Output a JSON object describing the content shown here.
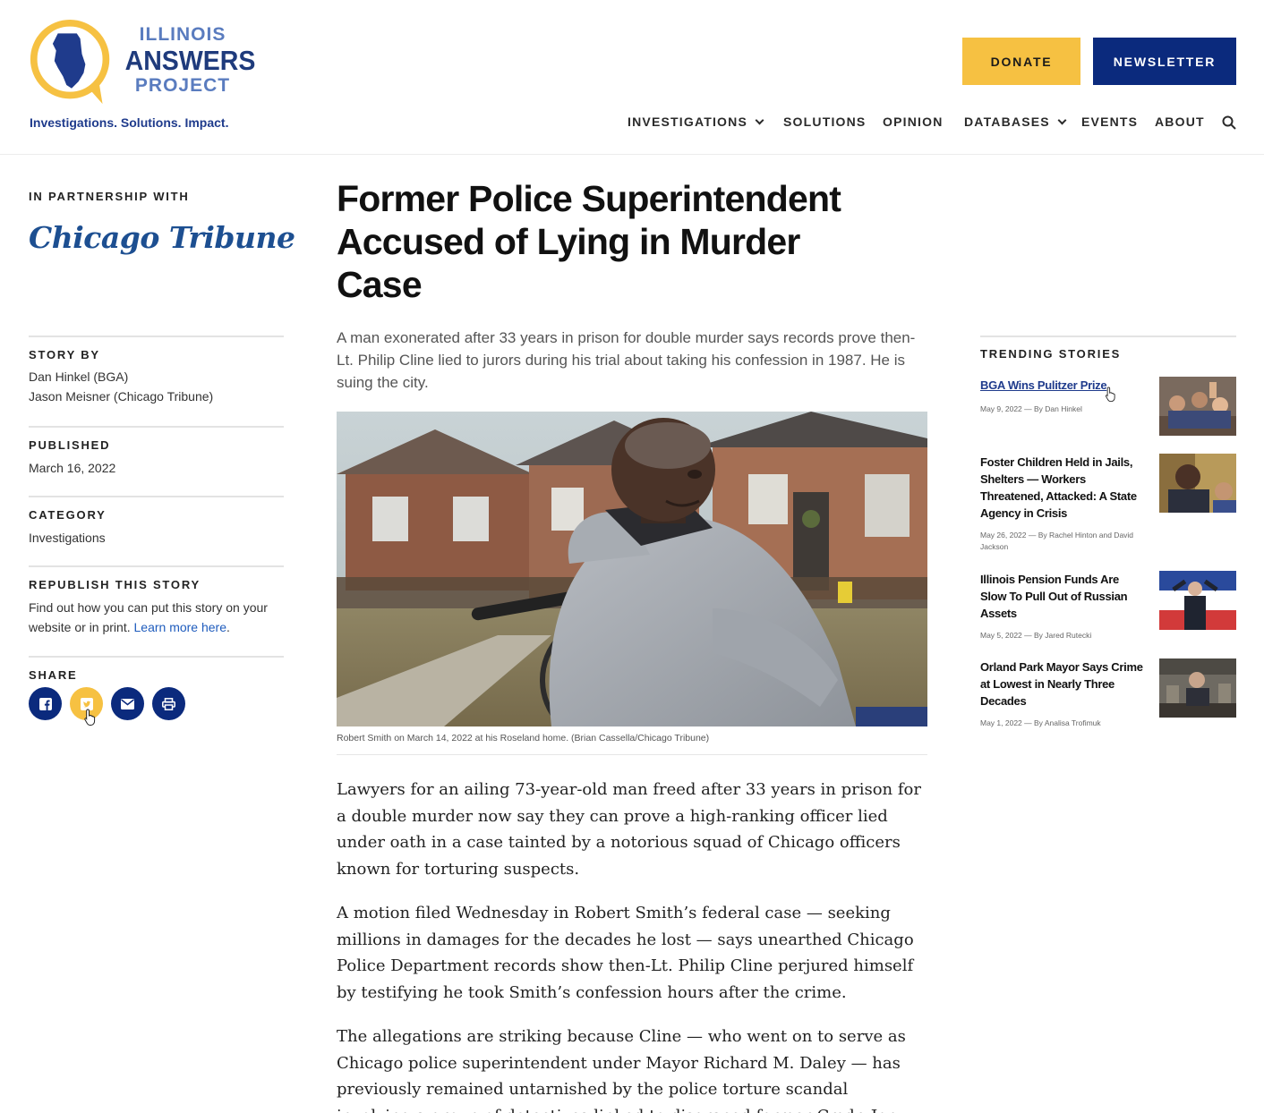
{
  "brand": {
    "logo_line1": "ILLINOIS",
    "logo_line2": "ANSWERS",
    "logo_line3": "PROJECT",
    "tagline": "Investigations. Solutions. Impact.",
    "primary_color": "#0b2a7d",
    "accent_color": "#f6c142"
  },
  "header": {
    "donate_label": "DONATE",
    "newsletter_label": "NEWSLETTER",
    "nav": [
      "INVESTIGATIONS",
      "SOLUTIONS",
      "OPINION",
      "DATABASES",
      "EVENTS",
      "ABOUT"
    ],
    "search_icon": "search-icon"
  },
  "sidebar": {
    "partner_label": "IN PARTNERSHIP WITH",
    "partner_name": "Chicago Tribune",
    "story_by_label": "STORY BY",
    "authors": [
      "Dan Hinkel (BGA)",
      "Jason Meisner (Chicago Tribune)"
    ],
    "published_label": "PUBLISHED",
    "published_date": "March 16, 2022",
    "category_label": "CATEGORY",
    "category": "Investigations",
    "republish_label": "REPUBLISH THIS STORY",
    "republish_text": "Find out how you can put this story on your website or in print.",
    "republish_link": "Learn more here",
    "republish_end": ".",
    "share_label": "SHARE",
    "share_icons": [
      "facebook-icon",
      "twitter-icon",
      "email-icon",
      "print-icon"
    ]
  },
  "article": {
    "headline": "Former Police Superintendent Accused of Lying in Murder Case",
    "dek": "A man exonerated after 33 years in prison for double murder says records prove then-Lt. Philip Cline lied to jurors during his trial about taking his confession in 1987. He is suing the city.",
    "caption": "Robert Smith on March 14, 2022 at his Roseland home. (Brian Cassella/Chicago Tribune)",
    "paragraphs": [
      "Lawyers for an ailing 73-year-old man freed after 33 years in prison for a double murder now say they can prove a high-ranking officer lied under oath in a case tainted by a notorious squad of Chicago officers known for torturing suspects.",
      "A motion filed Wednesday in Robert Smith’s federal case — seeking millions in damages for the decades he lost — says unearthed Chicago Police Department records show then-Lt. Philip Cline perjured himself by testifying he took Smith’s confession hours after the crime.",
      "The allegations are striking because Cline — who went on to serve as Chicago police superintendent under Mayor Richard M. Daley — has previously remained untarnished by the police torture scandal involving a group of detectives linked to disgraced former Cmdr. Jon"
    ]
  },
  "trending": {
    "label": "TRENDING STORIES",
    "items": [
      {
        "title": "BGA Wins Pulitzer Prize",
        "meta": "May 9, 2022 — By Dan Hinkel"
      },
      {
        "title": "Foster Children Held in Jails, Shelters — Workers Threatened, Attacked: A State Agency in Crisis",
        "meta": "May 26, 2022 — By Rachel Hinton and David Jackson"
      },
      {
        "title": "Illinois Pension Funds Are Slow To Pull Out of Russian Assets",
        "meta": "May 5, 2022 — By Jared Rutecki"
      },
      {
        "title": "Orland Park Mayor Says Crime at Lowest in Nearly Three Decades",
        "meta": "May 1, 2022 — By Analisa Trofimuk"
      }
    ]
  }
}
